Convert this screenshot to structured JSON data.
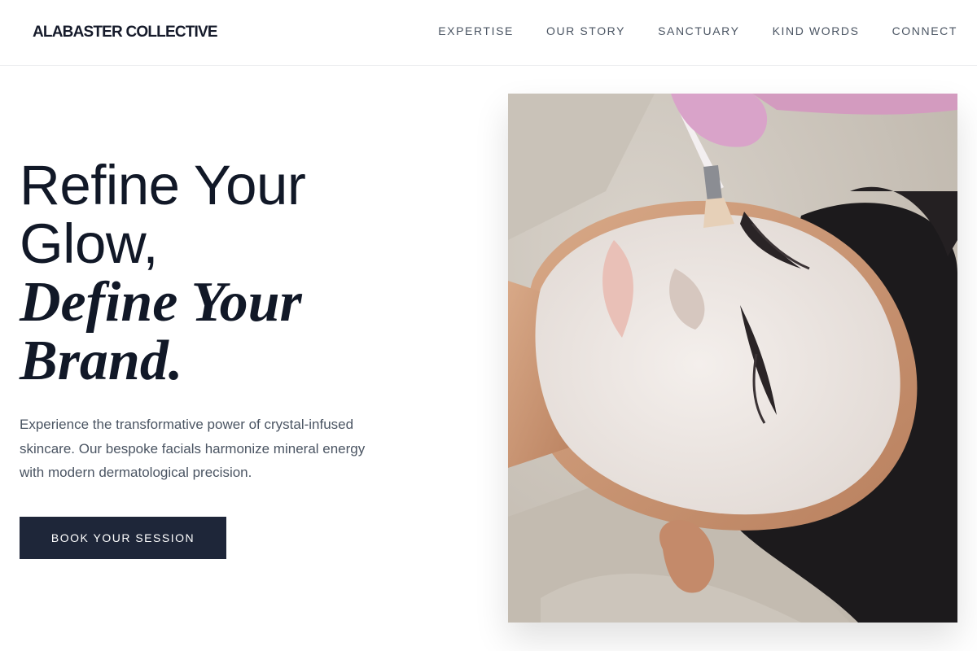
{
  "header": {
    "brand": "ALABASTER COLLECTIVE",
    "nav": [
      "EXPERTISE",
      "OUR STORY",
      "SANCTUARY",
      "KIND WORDS",
      "CONNECT"
    ]
  },
  "hero": {
    "headline_line1": "Refine Your",
    "headline_line2": "Glow,",
    "headline_line3": "Define Your",
    "headline_line4": "Brand.",
    "description": "Experience the transformative power of crystal-infused skincare. Our bespoke facials harmonize mineral energy with modern dermatological precision.",
    "cta_label": "BOOK YOUR SESSION"
  },
  "colors": {
    "ink": "#111827",
    "muted": "#4b5563",
    "button": "#1e2639"
  }
}
